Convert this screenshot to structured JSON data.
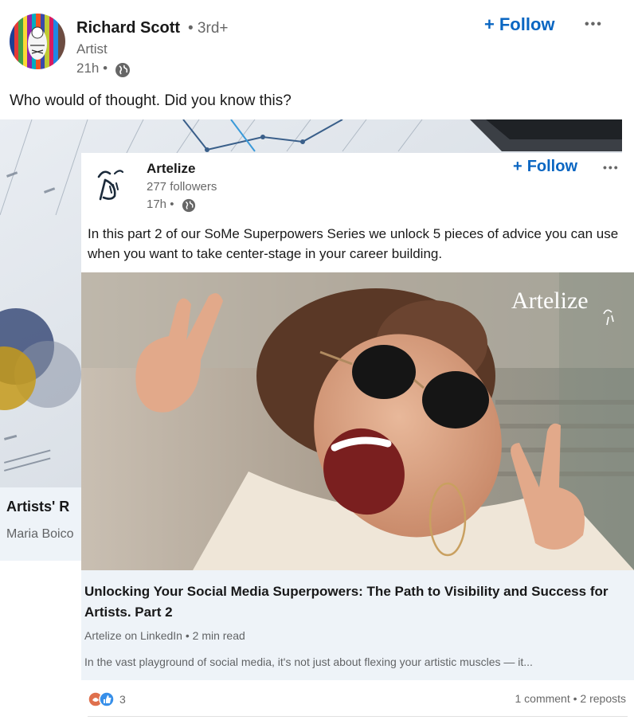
{
  "outer_post": {
    "author": {
      "name": "Richard Scott",
      "degree": "• 3rd+",
      "headline": "Artist",
      "time": "21h •"
    },
    "follow_label": "Follow",
    "more_label": "•••",
    "text": "Who would of thought. Did you know this?",
    "link_card": {
      "title": "Artists' R",
      "subtitle": "Maria Boico"
    }
  },
  "inner_post": {
    "author": {
      "name": "Artelize",
      "followers": "277 followers",
      "time": "17h •"
    },
    "follow_label": "Follow",
    "more_label": "•••",
    "text": "In this part 2 of our SoMe Superpowers Series we unlock 5 pieces of advice you can use when you want to take center-stage in your career building.",
    "image_watermark": "Artelize",
    "link_card": {
      "title": "Unlocking Your Social Media Superpowers: The Path to Visibility and Success for Artists. Part 2",
      "source": "Artelize on LinkedIn • 2 min read",
      "description": "In the vast playground of social media, it's not just about flexing your artistic muscles — it..."
    },
    "social": {
      "reaction_count": "3",
      "counts": "1 comment • 2 reposts"
    }
  },
  "colors": {
    "link_blue": "#0a66c2",
    "card_background": "#eef3f8"
  },
  "icons": [
    "globe-icon",
    "plus-icon",
    "more-icon",
    "celebrate-reaction-icon",
    "like-reaction-icon",
    "artelize-logo"
  ]
}
